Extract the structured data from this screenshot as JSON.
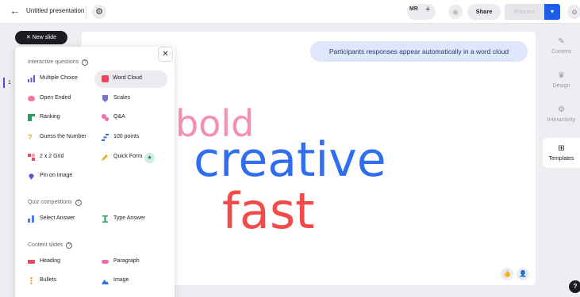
{
  "topbar": {
    "back_icon": "←",
    "title": "Untitled presentation",
    "settings_icon": "⚙",
    "avatar_initials": "MR",
    "add_icon": "+",
    "preview_icon": "◉",
    "share_label": "Share",
    "present_label": "Present",
    "present_menu_icon": "▾",
    "account_icon": "☺"
  },
  "rail": {
    "slide_number": "1"
  },
  "new_slide": {
    "label": "✕ New slide"
  },
  "menu": {
    "close_icon": "✕",
    "sections": [
      {
        "title": "Interactive questions",
        "help": "?"
      },
      {
        "title": "Quiz competitions",
        "help": "?"
      },
      {
        "title": "Content slides",
        "help": "?"
      }
    ],
    "items": [
      {
        "label": "Multiple Choice",
        "color": "#6b4fd8"
      },
      {
        "label": "Word Cloud",
        "color": "#e8485e"
      },
      {
        "label": "Open Ended",
        "color": "#f57ca0"
      },
      {
        "label": "Scales",
        "color": "#7b72e0"
      },
      {
        "label": "Ranking",
        "color": "#1fa35a"
      },
      {
        "label": "Q&A",
        "color": "#f06fa8"
      },
      {
        "label": "Guess the Number",
        "color": "#e8a01e"
      },
      {
        "label": "100 points",
        "color": "#2c6de8"
      },
      {
        "label": "2 x 2 Grid",
        "color": "#e8485e"
      },
      {
        "label": "Quick Form",
        "color": "#e8b21e"
      },
      {
        "label": "Pin on Image",
        "color": "#6b4fd8"
      },
      {
        "label": "Select Answer",
        "color": "#4f7be0"
      },
      {
        "label": "Type Answer",
        "color": "#1fa35a"
      },
      {
        "label": "Heading",
        "color": "#e8485e"
      },
      {
        "label": "Paragraph",
        "color": "#f06fa8"
      },
      {
        "label": "Bullets",
        "color": "#e8a01e"
      },
      {
        "label": "Image",
        "color": "#2c6de8"
      }
    ],
    "quick_form_badge": "★"
  },
  "slide": {
    "bubble_text": "Participants responses appear automatically in a word cloud",
    "words": [
      {
        "text": "bold",
        "color": "#f58db4"
      },
      {
        "text": "creative",
        "color": "#2f6ef0"
      },
      {
        "text": "fast",
        "color": "#f34a4a"
      }
    ],
    "reaction_icon": "👍",
    "participant_icon": "👤"
  },
  "right_panel": {
    "tabs": [
      {
        "label": "Content",
        "icon": "✎"
      },
      {
        "label": "Design",
        "icon": "♛"
      },
      {
        "label": "Interactivity",
        "icon": "⚙"
      },
      {
        "label": "Templates",
        "icon": "⊞"
      }
    ]
  },
  "help_icon": "?"
}
